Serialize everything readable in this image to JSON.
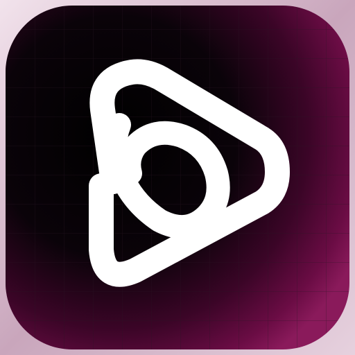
{
  "app_icon": {
    "icon": "play-loop-logo-icon",
    "colors": {
      "tile_dark": "#050205",
      "tile_glow": "#8a0f55",
      "tile_edge": "#d9bfd0",
      "grid_line": "#2a1524",
      "mark": "#ffffff"
    }
  }
}
